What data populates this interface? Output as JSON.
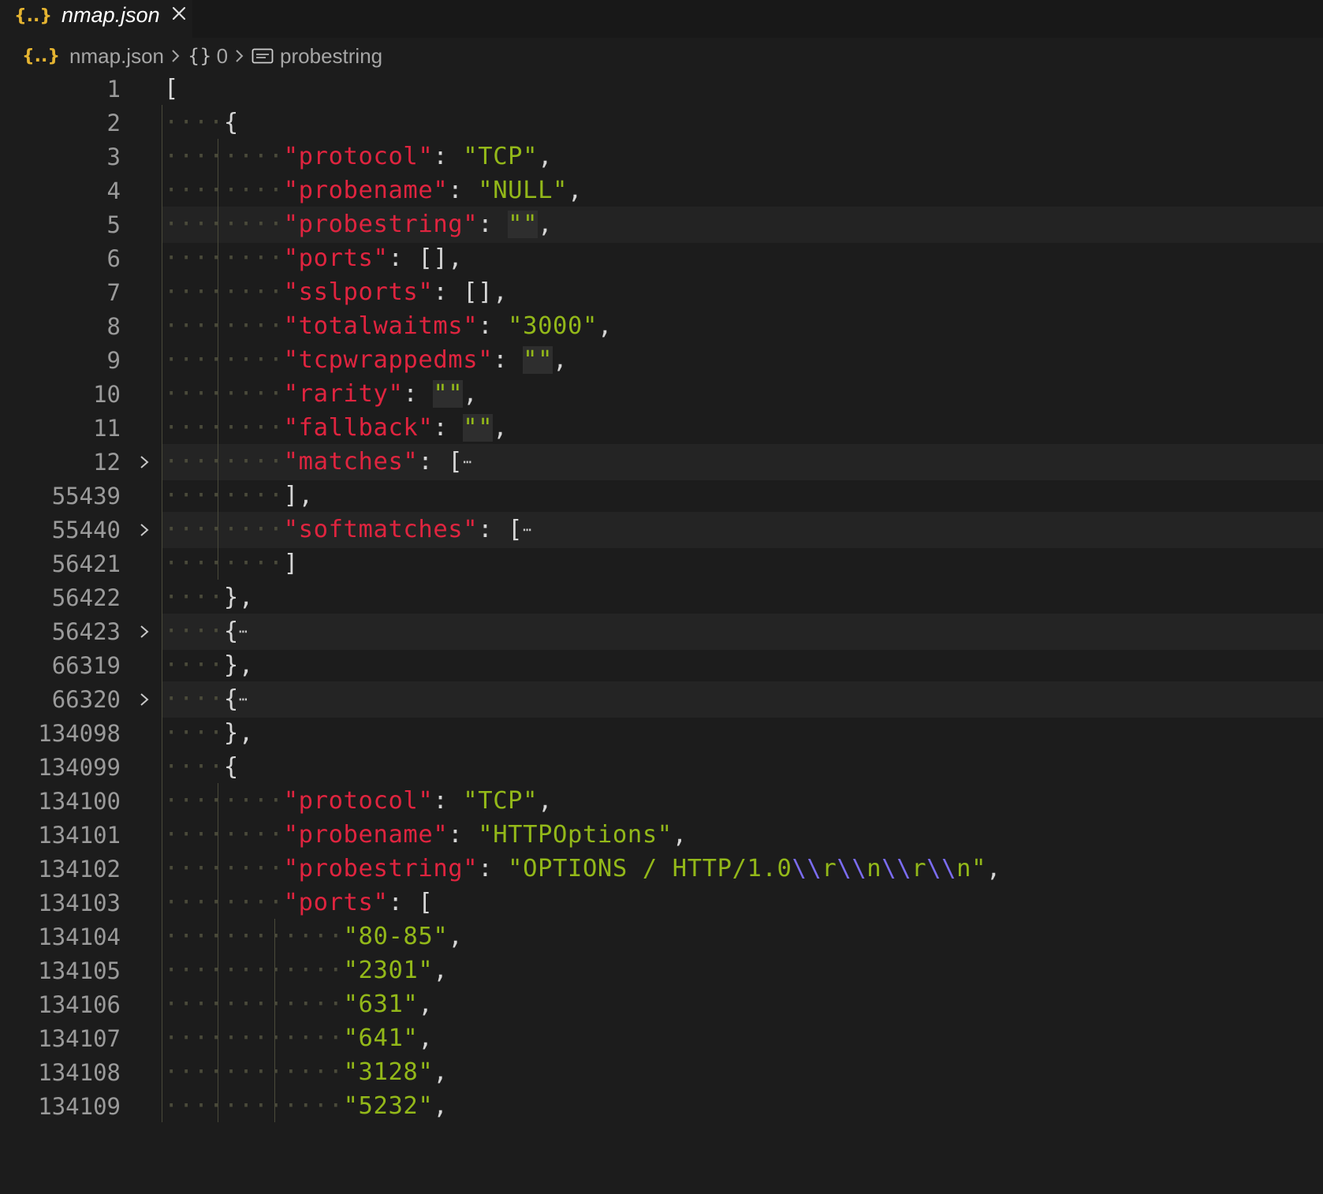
{
  "tab": {
    "title": "nmap.json",
    "icon": "{..}"
  },
  "breadcrumb": {
    "file": "nmap.json",
    "object": "0",
    "property": "probestring",
    "obj_icon": "{}"
  },
  "lines": [
    {
      "no": "1",
      "ws": "",
      "tokens": [
        [
          "p",
          "["
        ]
      ]
    },
    {
      "no": "2",
      "ws": "····",
      "tokens": [
        [
          "p",
          "{"
        ]
      ]
    },
    {
      "no": "3",
      "ws": "········",
      "tokens": [
        [
          "k",
          "\"protocol\""
        ],
        [
          "p",
          ": "
        ],
        [
          "s",
          "\"TCP\""
        ],
        [
          "p",
          ","
        ]
      ]
    },
    {
      "no": "4",
      "ws": "········",
      "tokens": [
        [
          "k",
          "\"probename\""
        ],
        [
          "p",
          ": "
        ],
        [
          "s",
          "\"NULL\""
        ],
        [
          "p",
          ","
        ]
      ]
    },
    {
      "no": "5",
      "ws": "········",
      "current": true,
      "tokens": [
        [
          "k",
          "\"probestring\""
        ],
        [
          "p",
          ": "
        ],
        [
          "e",
          "\"\""
        ],
        [
          "p",
          ","
        ]
      ]
    },
    {
      "no": "6",
      "ws": "········",
      "tokens": [
        [
          "k",
          "\"ports\""
        ],
        [
          "p",
          ": [],"
        ]
      ]
    },
    {
      "no": "7",
      "ws": "········",
      "tokens": [
        [
          "k",
          "\"sslports\""
        ],
        [
          "p",
          ": [],"
        ]
      ]
    },
    {
      "no": "8",
      "ws": "········",
      "tokens": [
        [
          "k",
          "\"totalwaitms\""
        ],
        [
          "p",
          ": "
        ],
        [
          "s",
          "\"3000\""
        ],
        [
          "p",
          ","
        ]
      ]
    },
    {
      "no": "9",
      "ws": "········",
      "tokens": [
        [
          "k",
          "\"tcpwrappedms\""
        ],
        [
          "p",
          ": "
        ],
        [
          "e",
          "\"\""
        ],
        [
          "p",
          ","
        ]
      ]
    },
    {
      "no": "10",
      "ws": "········",
      "tokens": [
        [
          "k",
          "\"rarity\""
        ],
        [
          "p",
          ": "
        ],
        [
          "e",
          "\"\""
        ],
        [
          "p",
          ","
        ]
      ]
    },
    {
      "no": "11",
      "ws": "········",
      "tokens": [
        [
          "k",
          "\"fallback\""
        ],
        [
          "p",
          ": "
        ],
        [
          "e",
          "\"\""
        ],
        [
          "p",
          ","
        ]
      ]
    },
    {
      "no": "12",
      "ws": "········",
      "folded": true,
      "tokens": [
        [
          "k",
          "\"matches\""
        ],
        [
          "p",
          ": ["
        ],
        [
          "x",
          "⋯"
        ]
      ]
    },
    {
      "no": "55439",
      "ws": "········",
      "tokens": [
        [
          "p",
          "],"
        ]
      ]
    },
    {
      "no": "55440",
      "ws": "········",
      "folded": true,
      "tokens": [
        [
          "k",
          "\"softmatches\""
        ],
        [
          "p",
          ": ["
        ],
        [
          "x",
          "⋯"
        ]
      ]
    },
    {
      "no": "56421",
      "ws": "········",
      "tokens": [
        [
          "p",
          "]"
        ]
      ]
    },
    {
      "no": "56422",
      "ws": "····",
      "tokens": [
        [
          "p",
          "},"
        ]
      ]
    },
    {
      "no": "56423",
      "ws": "····",
      "folded": true,
      "tokens": [
        [
          "p",
          "{"
        ],
        [
          "x",
          "⋯"
        ]
      ]
    },
    {
      "no": "66319",
      "ws": "····",
      "tokens": [
        [
          "p",
          "},"
        ]
      ]
    },
    {
      "no": "66320",
      "ws": "····",
      "folded": true,
      "tokens": [
        [
          "p",
          "{"
        ],
        [
          "x",
          "⋯"
        ]
      ]
    },
    {
      "no": "134098",
      "ws": "····",
      "tokens": [
        [
          "p",
          "},"
        ]
      ]
    },
    {
      "no": "134099",
      "ws": "····",
      "tokens": [
        [
          "p",
          "{"
        ]
      ]
    },
    {
      "no": "134100",
      "ws": "········",
      "tokens": [
        [
          "k",
          "\"protocol\""
        ],
        [
          "p",
          ": "
        ],
        [
          "s",
          "\"TCP\""
        ],
        [
          "p",
          ","
        ]
      ]
    },
    {
      "no": "134101",
      "ws": "········",
      "tokens": [
        [
          "k",
          "\"probename\""
        ],
        [
          "p",
          ": "
        ],
        [
          "s",
          "\"HTTPOptions\""
        ],
        [
          "p",
          ","
        ]
      ]
    },
    {
      "no": "134102",
      "ws": "········",
      "tokens": [
        [
          "k",
          "\"probestring\""
        ],
        [
          "p",
          ": "
        ],
        [
          "s",
          "\"OPTIONS / HTTP/1.0"
        ],
        [
          "c",
          "\\\\"
        ],
        [
          "s",
          "r"
        ],
        [
          "c",
          "\\\\"
        ],
        [
          "s",
          "n"
        ],
        [
          "c",
          "\\\\"
        ],
        [
          "s",
          "r"
        ],
        [
          "c",
          "\\\\"
        ],
        [
          "s",
          "n\""
        ],
        [
          "p",
          ","
        ]
      ]
    },
    {
      "no": "134103",
      "ws": "········",
      "tokens": [
        [
          "k",
          "\"ports\""
        ],
        [
          "p",
          ": ["
        ]
      ]
    },
    {
      "no": "134104",
      "ws": "············",
      "tokens": [
        [
          "s",
          "\"80-85\""
        ],
        [
          "p",
          ","
        ]
      ]
    },
    {
      "no": "134105",
      "ws": "············",
      "tokens": [
        [
          "s",
          "\"2301\""
        ],
        [
          "p",
          ","
        ]
      ]
    },
    {
      "no": "134106",
      "ws": "············",
      "tokens": [
        [
          "s",
          "\"631\""
        ],
        [
          "p",
          ","
        ]
      ]
    },
    {
      "no": "134107",
      "ws": "············",
      "tokens": [
        [
          "s",
          "\"641\""
        ],
        [
          "p",
          ","
        ]
      ]
    },
    {
      "no": "134108",
      "ws": "············",
      "tokens": [
        [
          "s",
          "\"3128\""
        ],
        [
          "p",
          ","
        ]
      ]
    },
    {
      "no": "134109",
      "ws": "············",
      "tokens": [
        [
          "s",
          "\"5232\""
        ],
        [
          "p",
          ","
        ]
      ]
    }
  ]
}
